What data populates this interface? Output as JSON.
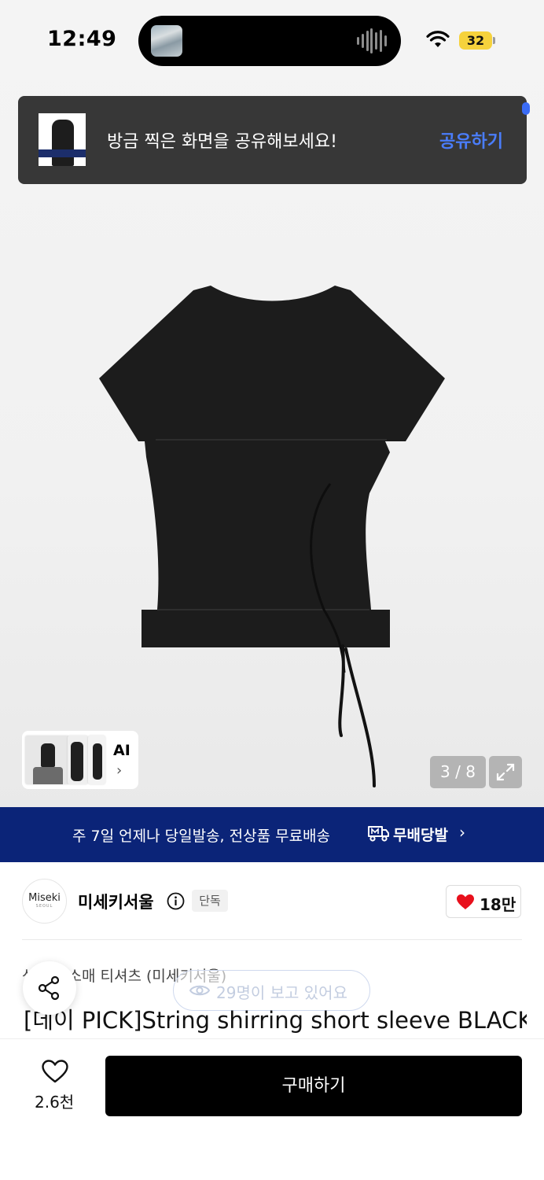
{
  "status_bar": {
    "time": "12:49",
    "battery": "32"
  },
  "share_toast": {
    "message": "방금 찍은 화면을 공유해보세요!",
    "action": "공유하기"
  },
  "gallery": {
    "ai_label": "AI",
    "ai_chevron": "›",
    "counter": "3 / 8",
    "expand_icon": "expand-icon"
  },
  "banner": {
    "text": "주 7일 언제나 당일발송, 전상품 무료배송",
    "brand": "무배당발",
    "chevron": "›"
  },
  "seller": {
    "logo_line1": "Miseki",
    "logo_line2": "SEOUL",
    "name": "미세키서울",
    "tag": "단독",
    "likes": "18만"
  },
  "product": {
    "category": "상의 반소매 티셔츠 (미세키서울)",
    "viewers": "29명이 보고 있어요",
    "title": "[데이 PICK]String shirring short sleeve BLACK"
  },
  "bottom_bar": {
    "wish_count": "2.6천",
    "buy_label": "구매하기"
  },
  "colors": {
    "banner": "#0b2478",
    "accent": "#4a7dfa",
    "heart": "#e8101c",
    "buy_button": "#000000"
  }
}
